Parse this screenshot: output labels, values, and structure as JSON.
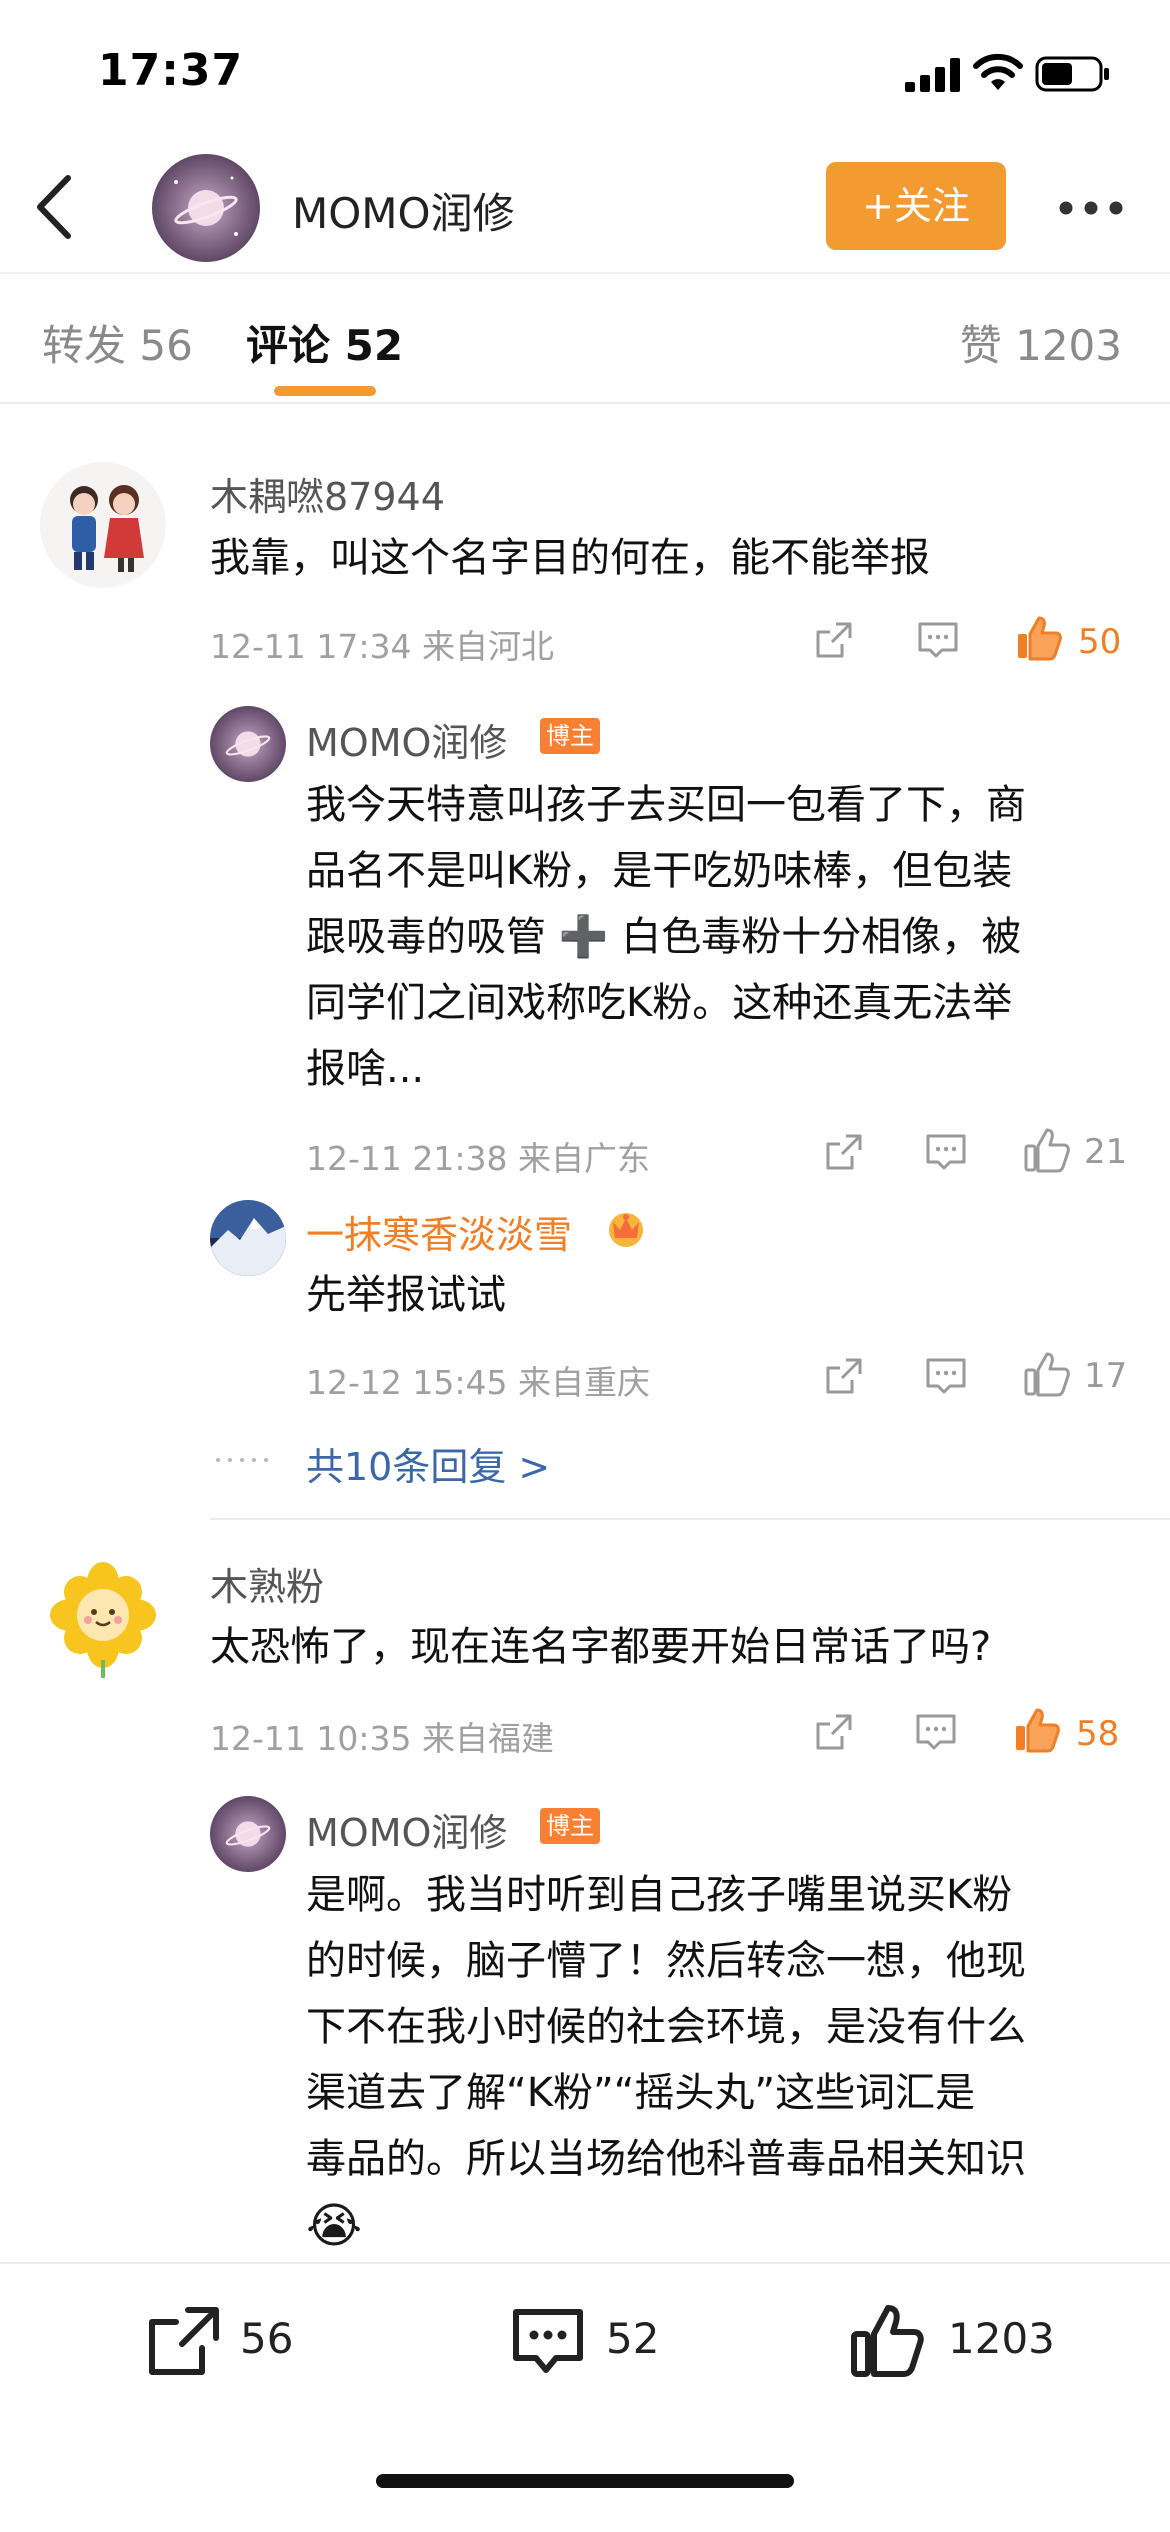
{
  "status_bar": {
    "time": "17:37"
  },
  "header": {
    "name": "MOMO润修",
    "follow_label": "+关注"
  },
  "tabs": {
    "forward": "转发 56",
    "comments": "评论 52",
    "likes": "赞 1203"
  },
  "comments": [
    {
      "user": "木耦嘫87944",
      "text": "我靠，叫这个名字目的何在，能不能举报",
      "meta": "12-11 17:34 来自河北",
      "likes": "50",
      "liked": true,
      "replies": [
        {
          "user": "MOMO润修",
          "badge": "博主",
          "lines": [
            "我今天特意叫孩子去买回一包看了下，商",
            "品名不是叫K粉，是干吃奶味棒，但包装",
            "跟吸毒的吸管 ➕ 白色毒粉十分相像，被",
            "同学们之间戏称吃K粉。这种还真无法举",
            "报啥..."
          ],
          "meta": "12-11 21:38 来自广东",
          "likes": "21"
        },
        {
          "user": "一抹寒香淡淡雪",
          "text": "先举报试试",
          "meta": "12-12 15:45 来自重庆",
          "likes": "17"
        }
      ],
      "more_replies": "共10条回复 >"
    },
    {
      "user": "木熟粉",
      "text": "太恐怖了，现在连名字都要开始日常话了吗?",
      "meta": "12-11 10:35 来自福建",
      "likes": "58",
      "liked": true,
      "replies": [
        {
          "user": "MOMO润修",
          "badge": "博主",
          "lines": [
            "是啊。我当时听到自己孩子嘴里说买K粉",
            "的时候，脑子懵了！然后转念一想，他现",
            "下不在我小时候的社会环境，是没有什么",
            "渠道去了解“K粉”“摇头丸”这些词汇是",
            "毒品的。所以当场给他科普毒品相关知识"
          ],
          "emoji": "😭"
        }
      ]
    }
  ],
  "bottom_bar": {
    "forward": "56",
    "comments": "52",
    "likes": "1203"
  },
  "colors": {
    "accent": "#f39a30",
    "liked": "#f07e24",
    "vip_name": "#f07e24"
  }
}
